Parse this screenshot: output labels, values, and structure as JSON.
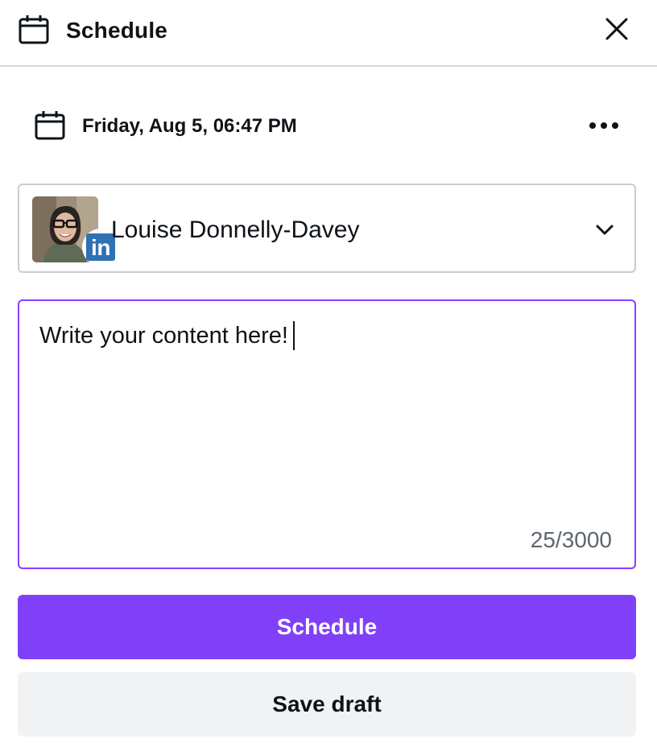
{
  "header": {
    "title": "Schedule",
    "icon": "calendar-icon",
    "close_icon": "close-icon"
  },
  "schedule": {
    "date_text": "Friday, Aug 5, 06:47 PM",
    "icon": "calendar-icon",
    "more_icon": "more-options-icon"
  },
  "account": {
    "name": "Louise Donnelly-Davey",
    "network": "LinkedIn",
    "network_badge": "in",
    "dropdown_icon": "chevron-down-icon"
  },
  "content": {
    "text": "Write your content here!",
    "char_count": "25/3000"
  },
  "buttons": {
    "schedule_label": "Schedule",
    "save_draft_label": "Save draft"
  },
  "colors": {
    "accent": "#8040f7",
    "focus_border": "#8b3dff",
    "linkedin": "#2f72b2",
    "secondary_button": "#f1f2f4"
  }
}
